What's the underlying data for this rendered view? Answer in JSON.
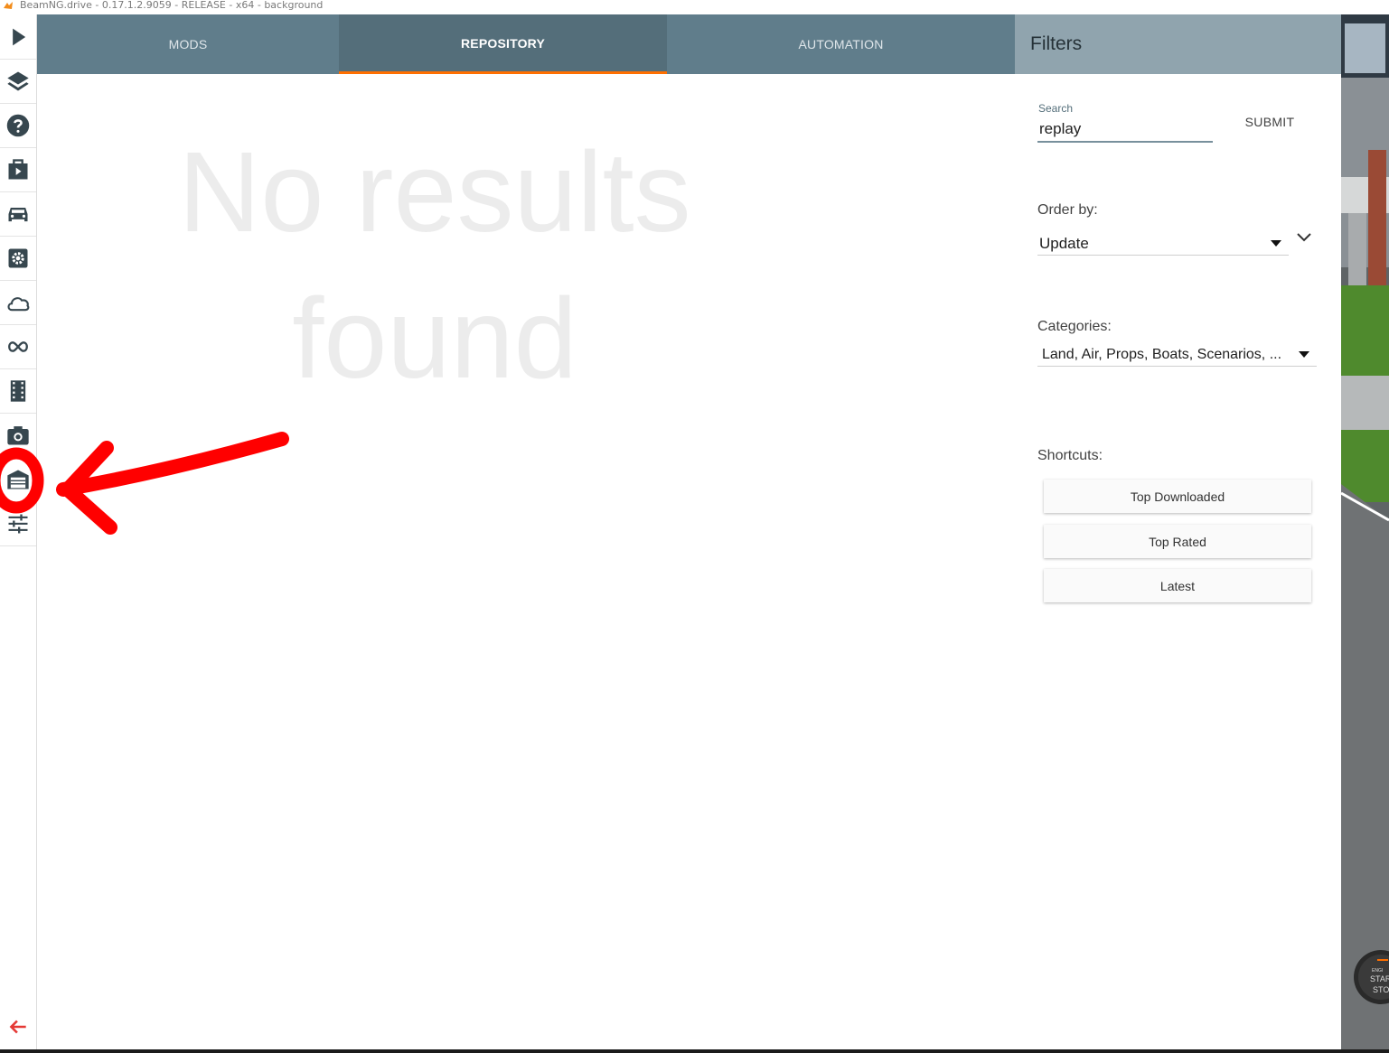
{
  "window": {
    "title": "BeamNG.drive - 0.17.1.2.9059 - RELEASE - x64 - background"
  },
  "sidebar": {
    "items": [
      {
        "icon": "play-icon"
      },
      {
        "icon": "layers-icon"
      },
      {
        "icon": "help-icon"
      },
      {
        "icon": "scenario-icon"
      },
      {
        "icon": "car-icon"
      },
      {
        "icon": "settings-icon"
      },
      {
        "icon": "cloud-icon"
      },
      {
        "icon": "infinity-icon"
      },
      {
        "icon": "film-icon"
      },
      {
        "icon": "camera-icon"
      },
      {
        "icon": "garage-icon"
      },
      {
        "icon": "sliders-icon"
      }
    ],
    "back_icon": "arrow-left-icon"
  },
  "tabs": [
    {
      "label": "MODS",
      "active": false
    },
    {
      "label": "REPOSITORY",
      "active": true
    },
    {
      "label": "AUTOMATION",
      "active": false
    }
  ],
  "main": {
    "empty_line1": "No results",
    "empty_line2": "found"
  },
  "filters": {
    "title": "Filters",
    "search_label": "Search",
    "search_value": "replay",
    "submit_label": "SUBMIT",
    "order_label": "Order by:",
    "order_value": "Update",
    "categories_label": "Categories:",
    "categories_value": "Land, Air, Props, Boats, Scenarios, ...",
    "shortcuts_label": "Shortcuts:",
    "shortcuts": [
      "Top Downloaded",
      "Top Rated",
      "Latest"
    ]
  },
  "game_hud": {
    "line1": "ENGI",
    "line2": "STAR",
    "line3": "STO"
  },
  "colors": {
    "tab_bar": "#607d8b",
    "tab_active": "#546e7a",
    "tab_indicator": "#ff6f00",
    "filters_header": "#90a4ae",
    "annotation_red": "#ff0000",
    "back_arrow": "#e53935"
  }
}
